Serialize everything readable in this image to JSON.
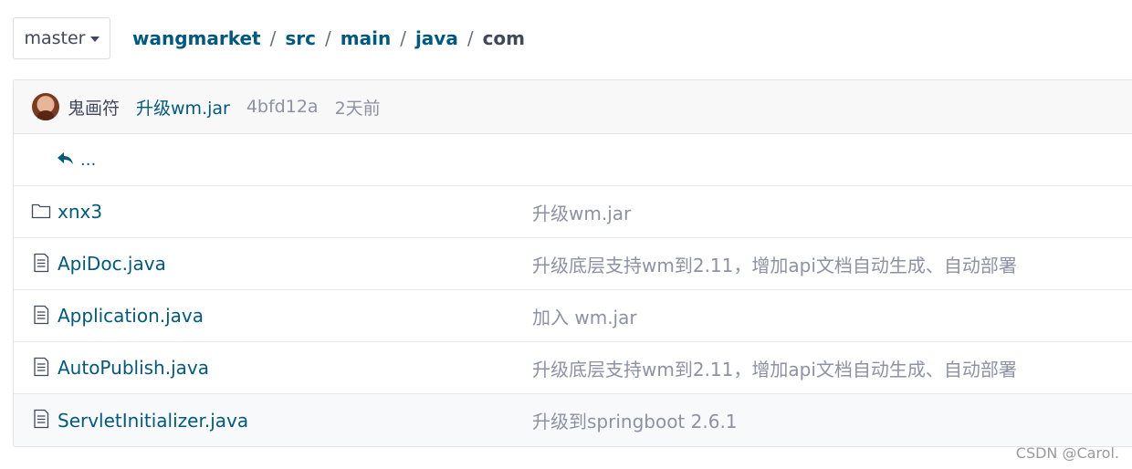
{
  "branch": {
    "label": "master"
  },
  "breadcrumb": {
    "links": [
      "wangmarket",
      "src",
      "main",
      "java"
    ],
    "separator": "/",
    "current": "com"
  },
  "latest_commit": {
    "author": "鬼画符",
    "message": "升级wm.jar",
    "sha": "4bfd12a",
    "time": "2天前"
  },
  "parent_link": {
    "icon": "reply-arrow-icon",
    "label": "..."
  },
  "files": [
    {
      "type": "folder",
      "icon": "folder-icon",
      "name": "xnx3",
      "commit": "升级wm.jar"
    },
    {
      "type": "file",
      "icon": "file-icon",
      "name": "ApiDoc.java",
      "commit": "升级底层支持wm到2.11，增加api文档自动生成、自动部署"
    },
    {
      "type": "file",
      "icon": "file-icon",
      "name": "Application.java",
      "commit": "加入 wm.jar"
    },
    {
      "type": "file",
      "icon": "file-icon",
      "name": "AutoPublish.java",
      "commit": "升级底层支持wm到2.11，增加api文档自动生成、自动部署"
    },
    {
      "type": "file",
      "icon": "file-icon",
      "name": "ServletInitializer.java",
      "commit": "升级到springboot 2.6.1"
    }
  ],
  "watermark": "CSDN @Carol.",
  "colors": {
    "link": "#005980",
    "muted": "#8c92a4",
    "text": "#40485b",
    "border": "#e3e4e8"
  }
}
